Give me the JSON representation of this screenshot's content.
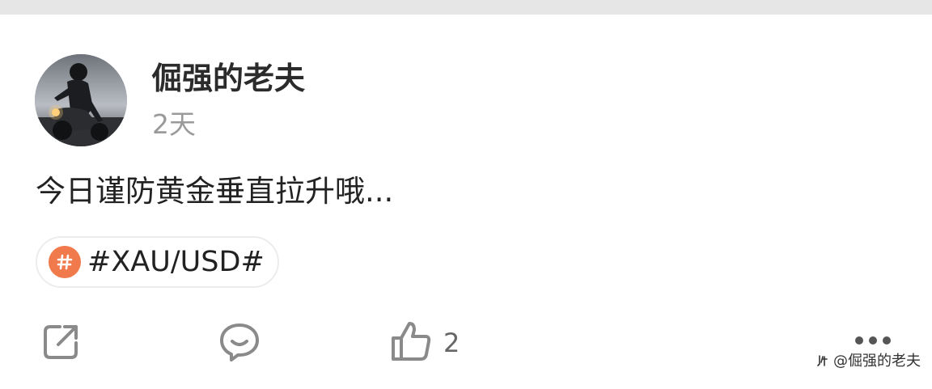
{
  "post": {
    "author": {
      "name": "倔强的老夫",
      "avatar": "motorcycle-rider-avatar"
    },
    "timestamp": "2天",
    "text": "今日谨防黄金垂直拉升哦...",
    "topic": {
      "icon": "hash-icon",
      "label": "#XAU/USD#",
      "accent": "#f07a4c"
    }
  },
  "actions": {
    "share_icon": "share-icon",
    "comment_icon": "comment-icon",
    "like_icon": "thumbs-up-icon",
    "like_count": "2",
    "more_icon": "more-icon"
  },
  "watermark": {
    "text": "@倔强的老夫"
  }
}
